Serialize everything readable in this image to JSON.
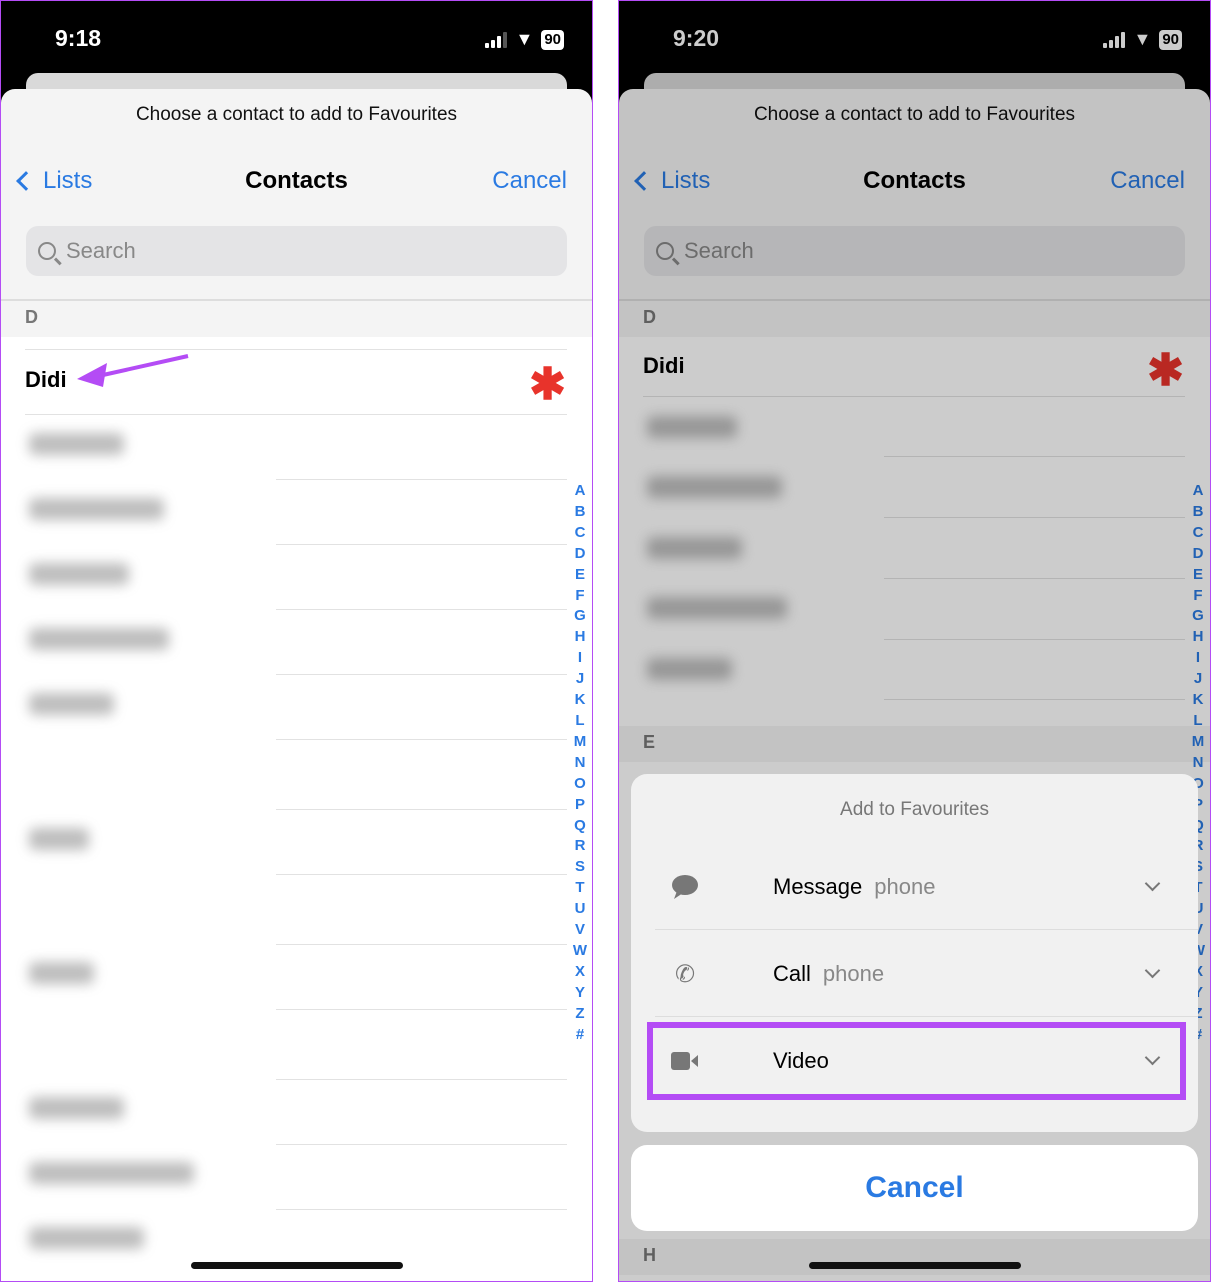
{
  "left": {
    "time": "9:18",
    "battery": "90",
    "prompt": "Choose a contact to add to Favourites",
    "back_label": "Lists",
    "title": "Contacts",
    "cancel": "Cancel",
    "search_placeholder": "Search",
    "section": "D",
    "contact": "Didi"
  },
  "right": {
    "time": "9:20",
    "battery": "90",
    "prompt": "Choose a contact to add to Favourites",
    "back_label": "Lists",
    "title": "Contacts",
    "cancel": "Cancel",
    "search_placeholder": "Search",
    "section": "D",
    "contact": "Didi",
    "section_e": "E",
    "section_h": "H",
    "action_sheet": {
      "title": "Add to Favourites",
      "items": [
        {
          "label": "Message",
          "sub": "phone",
          "icon": "message-bubble-icon"
        },
        {
          "label": "Call",
          "sub": "phone",
          "icon": "phone-icon"
        },
        {
          "label": "Video",
          "sub": "",
          "icon": "video-camera-icon"
        }
      ],
      "cancel": "Cancel"
    }
  },
  "index_letters": [
    "A",
    "B",
    "C",
    "D",
    "E",
    "F",
    "G",
    "H",
    "I",
    "J",
    "K",
    "L",
    "M",
    "N",
    "O",
    "P",
    "Q",
    "R",
    "S",
    "T",
    "U",
    "V",
    "W",
    "X",
    "Y",
    "Z",
    "#"
  ],
  "colors": {
    "accent": "#2a7ae2",
    "highlight": "#b44cf5",
    "favourite_star": "#e8332b"
  }
}
